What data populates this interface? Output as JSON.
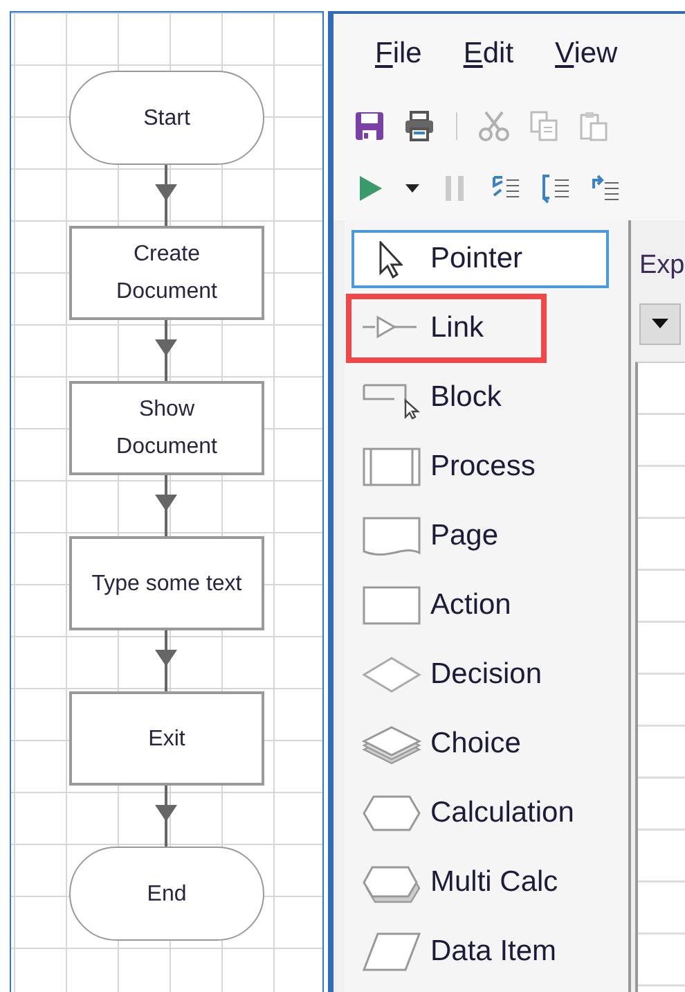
{
  "flowchart": {
    "nodes": [
      {
        "kind": "terminator",
        "label": "Start"
      },
      {
        "kind": "process",
        "label": "Create Document"
      },
      {
        "kind": "process",
        "label": "Show Document"
      },
      {
        "kind": "process",
        "label": "Type some text"
      },
      {
        "kind": "process",
        "label": "Exit"
      },
      {
        "kind": "terminator",
        "label": "End"
      }
    ]
  },
  "window": {
    "menu": [
      "File",
      "Edit",
      "View"
    ],
    "toolbar_1": [
      {
        "kind": "save",
        "disabled": false
      },
      {
        "kind": "print",
        "disabled": false
      },
      {
        "kind": "separator"
      },
      {
        "kind": "cut",
        "disabled": true
      },
      {
        "kind": "copy",
        "disabled": true
      },
      {
        "kind": "paste",
        "disabled": true
      }
    ],
    "toolbar_2": [
      {
        "kind": "run",
        "disabled": false
      },
      {
        "kind": "dropdown",
        "disabled": false
      },
      {
        "kind": "pause",
        "disabled": true
      },
      {
        "kind": "step-in",
        "disabled": false
      },
      {
        "kind": "step-over",
        "disabled": false
      },
      {
        "kind": "step-out",
        "disabled": false
      }
    ],
    "toolbox": [
      {
        "kind": "pointer",
        "label": "Pointer",
        "selected": true,
        "highlighted": false
      },
      {
        "kind": "link",
        "label": "Link",
        "selected": false,
        "highlighted": true
      },
      {
        "kind": "block",
        "label": "Block",
        "selected": false,
        "highlighted": false
      },
      {
        "kind": "process",
        "label": "Process",
        "selected": false,
        "highlighted": false
      },
      {
        "kind": "page",
        "label": "Page",
        "selected": false,
        "highlighted": false
      },
      {
        "kind": "action",
        "label": "Action",
        "selected": false,
        "highlighted": false
      },
      {
        "kind": "decision",
        "label": "Decision",
        "selected": false,
        "highlighted": false
      },
      {
        "kind": "choice",
        "label": "Choice",
        "selected": false,
        "highlighted": false
      },
      {
        "kind": "calculation",
        "label": "Calculation",
        "selected": false,
        "highlighted": false
      },
      {
        "kind": "multi-calc",
        "label": "Multi Calc",
        "selected": false,
        "highlighted": false
      },
      {
        "kind": "data-item",
        "label": "Data Item",
        "selected": false,
        "highlighted": false
      }
    ],
    "explorer": {
      "label": "Exp"
    }
  }
}
